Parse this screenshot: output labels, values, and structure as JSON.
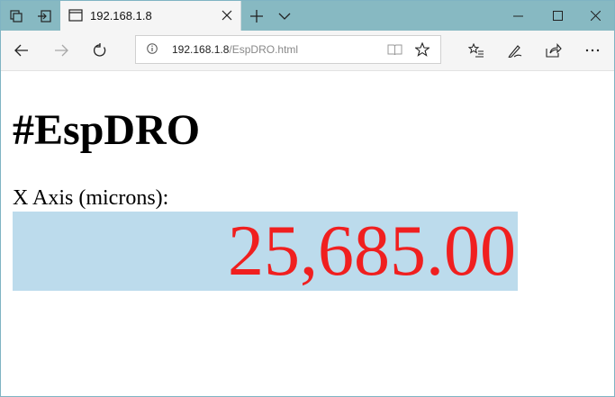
{
  "browser": {
    "tab": {
      "title": "192.168.1.8"
    },
    "address": {
      "host": "192.168.1.8",
      "path": "/EspDRO.html"
    }
  },
  "page": {
    "title": "#EspDRO",
    "axis_label": "X Axis (microns):",
    "axis_value": "25,685.00"
  },
  "colors": {
    "readout_bg": "#bcdbec",
    "readout_text": "#f01f1f",
    "tabbar_bg": "#87b9c2"
  }
}
